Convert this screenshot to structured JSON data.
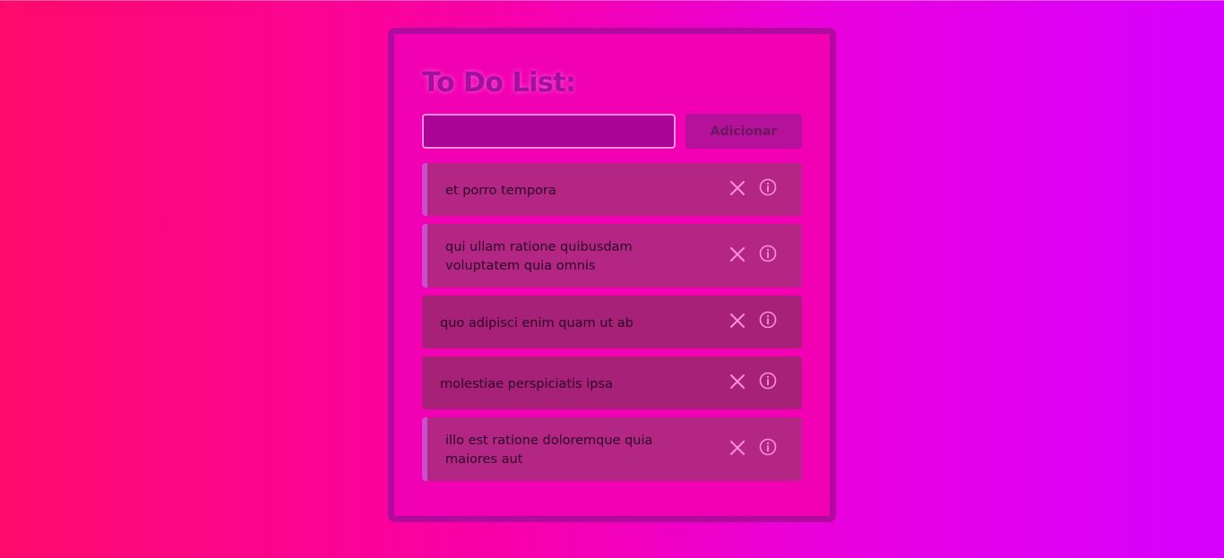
{
  "app": {
    "title": "To Do List:"
  },
  "form": {
    "input_value": "",
    "input_placeholder": "",
    "add_label": "Adicionar"
  },
  "tasks": [
    {
      "text": "et porro tempora"
    },
    {
      "text": "qui ullam ratione quibusdam voluptatem quia omnis"
    },
    {
      "text": "quo adipisci enim quam ut ab"
    },
    {
      "text": "molestiae perspiciatis ipsa"
    },
    {
      "text": "illo est ratione doloremque quia maiores aut"
    }
  ],
  "icons": {
    "remove": "close-icon",
    "details": "info-icon"
  },
  "colors": {
    "icon": "#ff8ee0",
    "title": "#a2109f",
    "card_border": "#b10a9f"
  }
}
